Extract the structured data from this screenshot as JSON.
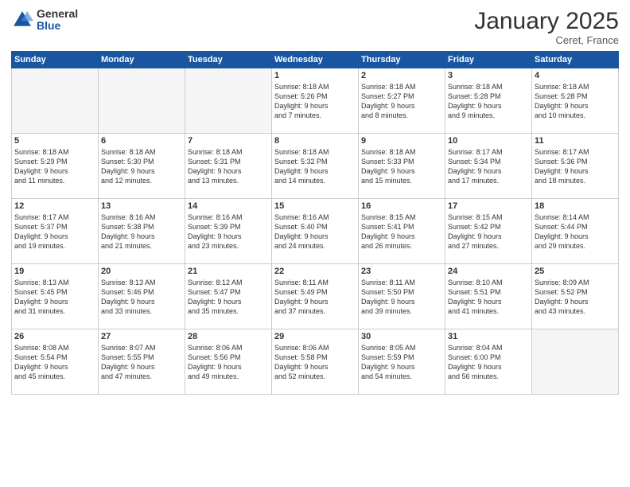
{
  "logo": {
    "general": "General",
    "blue": "Blue"
  },
  "title": "January 2025",
  "location": "Ceret, France",
  "headers": [
    "Sunday",
    "Monday",
    "Tuesday",
    "Wednesday",
    "Thursday",
    "Friday",
    "Saturday"
  ],
  "weeks": [
    [
      {
        "day": "",
        "info": ""
      },
      {
        "day": "",
        "info": ""
      },
      {
        "day": "",
        "info": ""
      },
      {
        "day": "1",
        "info": "Sunrise: 8:18 AM\nSunset: 5:26 PM\nDaylight: 9 hours\nand 7 minutes."
      },
      {
        "day": "2",
        "info": "Sunrise: 8:18 AM\nSunset: 5:27 PM\nDaylight: 9 hours\nand 8 minutes."
      },
      {
        "day": "3",
        "info": "Sunrise: 8:18 AM\nSunset: 5:28 PM\nDaylight: 9 hours\nand 9 minutes."
      },
      {
        "day": "4",
        "info": "Sunrise: 8:18 AM\nSunset: 5:28 PM\nDaylight: 9 hours\nand 10 minutes."
      }
    ],
    [
      {
        "day": "5",
        "info": "Sunrise: 8:18 AM\nSunset: 5:29 PM\nDaylight: 9 hours\nand 11 minutes."
      },
      {
        "day": "6",
        "info": "Sunrise: 8:18 AM\nSunset: 5:30 PM\nDaylight: 9 hours\nand 12 minutes."
      },
      {
        "day": "7",
        "info": "Sunrise: 8:18 AM\nSunset: 5:31 PM\nDaylight: 9 hours\nand 13 minutes."
      },
      {
        "day": "8",
        "info": "Sunrise: 8:18 AM\nSunset: 5:32 PM\nDaylight: 9 hours\nand 14 minutes."
      },
      {
        "day": "9",
        "info": "Sunrise: 8:18 AM\nSunset: 5:33 PM\nDaylight: 9 hours\nand 15 minutes."
      },
      {
        "day": "10",
        "info": "Sunrise: 8:17 AM\nSunset: 5:34 PM\nDaylight: 9 hours\nand 17 minutes."
      },
      {
        "day": "11",
        "info": "Sunrise: 8:17 AM\nSunset: 5:36 PM\nDaylight: 9 hours\nand 18 minutes."
      }
    ],
    [
      {
        "day": "12",
        "info": "Sunrise: 8:17 AM\nSunset: 5:37 PM\nDaylight: 9 hours\nand 19 minutes."
      },
      {
        "day": "13",
        "info": "Sunrise: 8:16 AM\nSunset: 5:38 PM\nDaylight: 9 hours\nand 21 minutes."
      },
      {
        "day": "14",
        "info": "Sunrise: 8:16 AM\nSunset: 5:39 PM\nDaylight: 9 hours\nand 23 minutes."
      },
      {
        "day": "15",
        "info": "Sunrise: 8:16 AM\nSunset: 5:40 PM\nDaylight: 9 hours\nand 24 minutes."
      },
      {
        "day": "16",
        "info": "Sunrise: 8:15 AM\nSunset: 5:41 PM\nDaylight: 9 hours\nand 26 minutes."
      },
      {
        "day": "17",
        "info": "Sunrise: 8:15 AM\nSunset: 5:42 PM\nDaylight: 9 hours\nand 27 minutes."
      },
      {
        "day": "18",
        "info": "Sunrise: 8:14 AM\nSunset: 5:44 PM\nDaylight: 9 hours\nand 29 minutes."
      }
    ],
    [
      {
        "day": "19",
        "info": "Sunrise: 8:13 AM\nSunset: 5:45 PM\nDaylight: 9 hours\nand 31 minutes."
      },
      {
        "day": "20",
        "info": "Sunrise: 8:13 AM\nSunset: 5:46 PM\nDaylight: 9 hours\nand 33 minutes."
      },
      {
        "day": "21",
        "info": "Sunrise: 8:12 AM\nSunset: 5:47 PM\nDaylight: 9 hours\nand 35 minutes."
      },
      {
        "day": "22",
        "info": "Sunrise: 8:11 AM\nSunset: 5:49 PM\nDaylight: 9 hours\nand 37 minutes."
      },
      {
        "day": "23",
        "info": "Sunrise: 8:11 AM\nSunset: 5:50 PM\nDaylight: 9 hours\nand 39 minutes."
      },
      {
        "day": "24",
        "info": "Sunrise: 8:10 AM\nSunset: 5:51 PM\nDaylight: 9 hours\nand 41 minutes."
      },
      {
        "day": "25",
        "info": "Sunrise: 8:09 AM\nSunset: 5:52 PM\nDaylight: 9 hours\nand 43 minutes."
      }
    ],
    [
      {
        "day": "26",
        "info": "Sunrise: 8:08 AM\nSunset: 5:54 PM\nDaylight: 9 hours\nand 45 minutes."
      },
      {
        "day": "27",
        "info": "Sunrise: 8:07 AM\nSunset: 5:55 PM\nDaylight: 9 hours\nand 47 minutes."
      },
      {
        "day": "28",
        "info": "Sunrise: 8:06 AM\nSunset: 5:56 PM\nDaylight: 9 hours\nand 49 minutes."
      },
      {
        "day": "29",
        "info": "Sunrise: 8:06 AM\nSunset: 5:58 PM\nDaylight: 9 hours\nand 52 minutes."
      },
      {
        "day": "30",
        "info": "Sunrise: 8:05 AM\nSunset: 5:59 PM\nDaylight: 9 hours\nand 54 minutes."
      },
      {
        "day": "31",
        "info": "Sunrise: 8:04 AM\nSunset: 6:00 PM\nDaylight: 9 hours\nand 56 minutes."
      },
      {
        "day": "",
        "info": ""
      }
    ]
  ]
}
